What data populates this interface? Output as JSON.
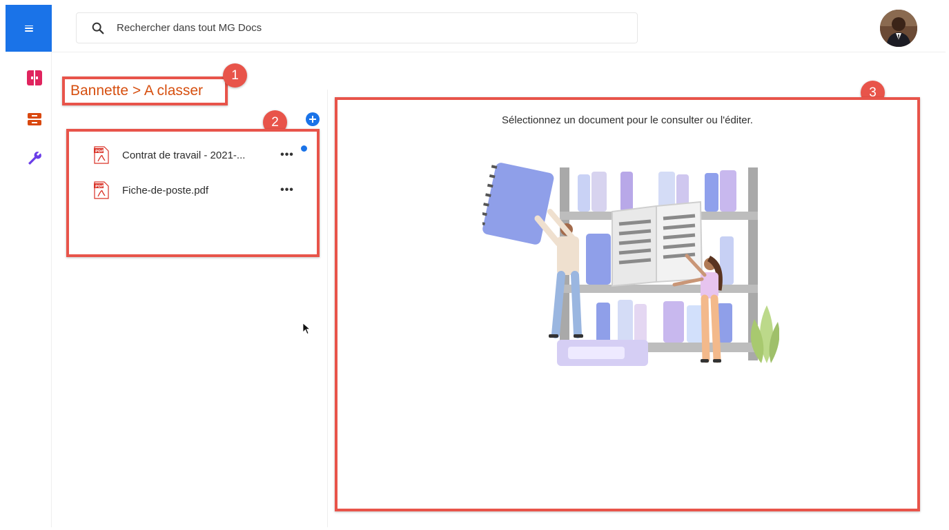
{
  "header": {
    "menu_icon": "hamburger-icon",
    "search": {
      "placeholder": "Rechercher dans tout MG Docs",
      "icon": "search-icon"
    },
    "avatar_icon": "user-avatar"
  },
  "sidebar": {
    "items": [
      {
        "name": "documents",
        "icon": "split-document-icon",
        "color": "#e0245e"
      },
      {
        "name": "inbox",
        "icon": "inbox-tray-icon",
        "color": "#d9480f"
      },
      {
        "name": "settings",
        "icon": "wrench-icon",
        "color": "#6a3de8"
      }
    ]
  },
  "breadcrumb": {
    "text": "Bannette > A classer"
  },
  "files": [
    {
      "name": "Contrat de travail - 2021-...",
      "type": "pdf",
      "unread": true
    },
    {
      "name": "Fiche-de-poste.pdf",
      "type": "pdf",
      "unread": false
    }
  ],
  "viewer": {
    "message": "Sélectionnez un document pour le consulter ou l'éditer."
  },
  "annotations": [
    "1",
    "2",
    "3"
  ],
  "colors": {
    "accent": "#1a73e8",
    "highlight": "#e8544a",
    "breadcrumb": "#d64f0f"
  }
}
